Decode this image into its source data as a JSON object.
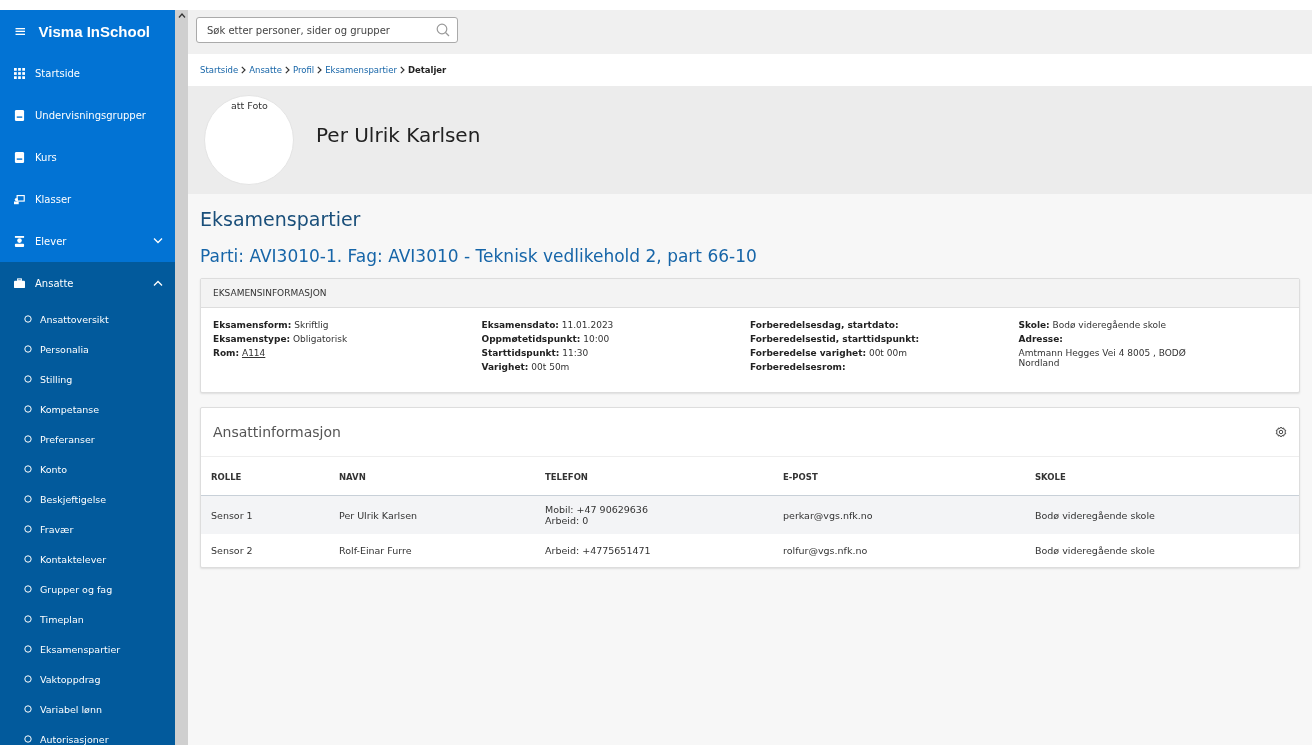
{
  "sidebar": {
    "brand": "Visma InSchool",
    "menu_glyph": "≡",
    "items": [
      {
        "label": "Startside",
        "selected": false
      },
      {
        "label": "Undervisningsgrupper",
        "selected": false
      },
      {
        "label": "Kurs",
        "selected": false
      },
      {
        "label": "Klasser",
        "selected": false
      },
      {
        "label": "Elever",
        "selected": false,
        "expanded": false
      },
      {
        "label": "Ansatte",
        "selected": true,
        "expanded": true,
        "children": [
          {
            "label": "Ansattoversikt"
          },
          {
            "label": "Personalia"
          },
          {
            "label": "Stilling"
          },
          {
            "label": "Kompetanse"
          },
          {
            "label": "Preferanser"
          },
          {
            "label": "Konto"
          },
          {
            "label": "Beskjeftigelse"
          },
          {
            "label": "Fravær"
          },
          {
            "label": "Kontaktelever"
          },
          {
            "label": "Grupper og fag"
          },
          {
            "label": "Timeplan"
          },
          {
            "label": "Eksamenspartier"
          },
          {
            "label": "Vaktoppdrag"
          },
          {
            "label": "Variabel lønn"
          },
          {
            "label": "Autorisasjoner"
          }
        ]
      }
    ]
  },
  "search": {
    "placeholder": "Søk etter personer, sider og grupper"
  },
  "breadcrumb": [
    {
      "label": "Startside",
      "current": false
    },
    {
      "label": "Ansatte",
      "current": false
    },
    {
      "label": "Profil",
      "current": false
    },
    {
      "label": "Eksamenspartier",
      "current": false
    },
    {
      "label": "Detaljer",
      "current": true
    }
  ],
  "profile": {
    "photo_label": "att Foto",
    "name": "Per Ulrik Karlsen"
  },
  "page_title": "Eksamenspartier",
  "subtitle": "Parti: AVI3010-1. Fag: AVI3010 - Teknisk vedlikehold 2, part 66-10",
  "exam_info": {
    "title": "EKSAMENSINFORMASJON",
    "columns": [
      [
        {
          "kind": "pair",
          "label": "Eksamensform:",
          "value": "Skriftlig"
        },
        {
          "kind": "pair",
          "label": "Eksamenstype:",
          "value": "Obligatorisk"
        },
        {
          "kind": "link",
          "label": "Rom:",
          "value": "A114"
        }
      ],
      [
        {
          "kind": "pair",
          "label": "Eksamensdato:",
          "value": "11.01.2023"
        },
        {
          "kind": "pair",
          "label": "Oppmøtetidspunkt:",
          "value": "10:00"
        },
        {
          "kind": "pair",
          "label": "Starttidspunkt:",
          "value": "11:30"
        },
        {
          "kind": "pair",
          "label": "Varighet:",
          "value": "00t 50m"
        }
      ],
      [
        {
          "kind": "pair",
          "label": "Forberedelsesdag, startdato:"
        },
        {
          "kind": "pair",
          "label": "Forberedelsestid, starttidspunkt:"
        },
        {
          "kind": "pair",
          "label": "Forberedelse varighet:",
          "value": "00t 00m"
        },
        {
          "kind": "pair",
          "label": "Forberedelsesrom:"
        }
      ],
      [
        {
          "kind": "pair",
          "label": "Skole:",
          "value": "Bodø videregående skole"
        },
        {
          "kind": "pair",
          "label": "Adresse:"
        },
        {
          "kind": "text",
          "value": "Amtmann Hegges Vei 4 8005 , BODØ Nordland"
        }
      ]
    ]
  },
  "staff": {
    "title": "Ansattinformasjon",
    "columns": [
      "ROLLE",
      "NAVN",
      "TELEFON",
      "E-POST",
      "SKOLE"
    ],
    "rows": [
      {
        "selected": true,
        "cells": [
          [
            "Sensor 1"
          ],
          [
            "Per Ulrik Karlsen"
          ],
          [
            "Mobil: +47 90629636",
            "Arbeid: 0"
          ],
          [
            "perkar@vgs.nfk.no"
          ],
          [
            "Bodø videregående skole"
          ]
        ]
      },
      {
        "selected": false,
        "cells": [
          [
            "Sensor 2"
          ],
          [
            "Rolf-Einar Furre"
          ],
          [
            "Arbeid: +4775651471"
          ],
          [
            "rolfur@vgs.nfk.no"
          ],
          [
            "Bodø videregående skole"
          ]
        ]
      }
    ]
  }
}
